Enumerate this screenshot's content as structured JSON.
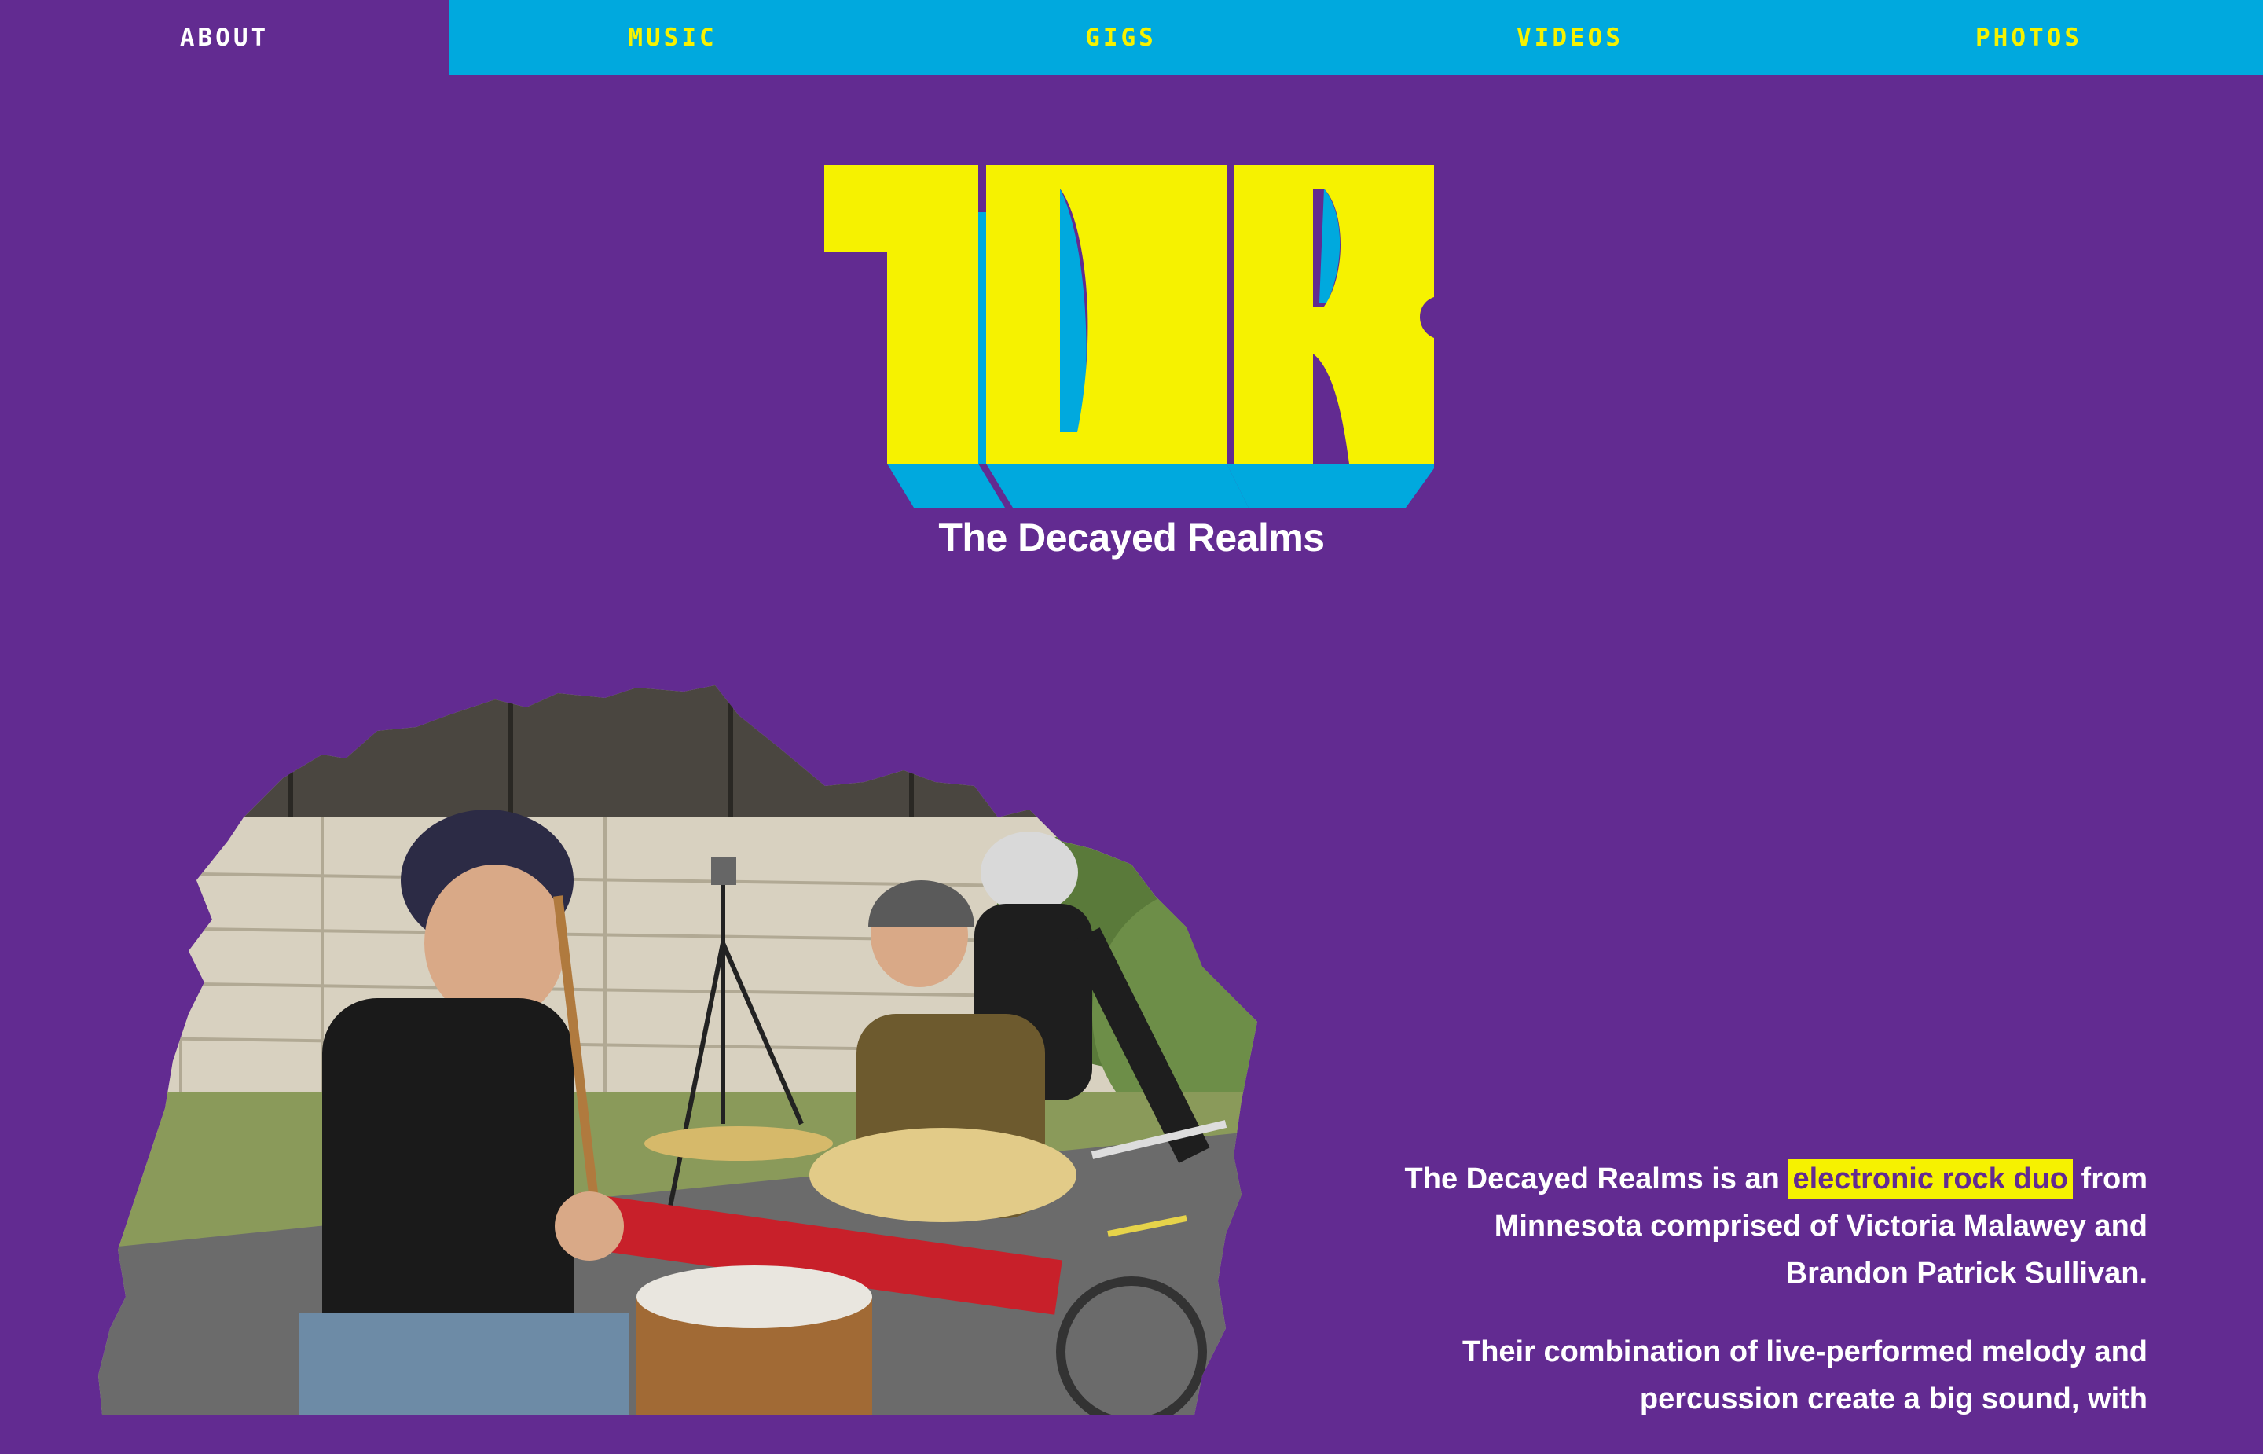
{
  "nav": {
    "items": [
      {
        "label": "ABOUT",
        "active": true
      },
      {
        "label": "MUSIC",
        "active": false
      },
      {
        "label": "GIGS",
        "active": false
      },
      {
        "label": "VIDEOS",
        "active": false
      },
      {
        "label": "PHOTOS",
        "active": false
      }
    ]
  },
  "logo": {
    "lettering": "TDR"
  },
  "header": {
    "band_name": "The Decayed Realms"
  },
  "about": {
    "p1_before": "The Decayed Realms is an ",
    "p1_highlight": "electronic rock duo",
    "p1_after": " from Minnesota comprised of Victoria Malawey and Brandon Patrick Sullivan.",
    "p2": "Their combination of live-performed melody and percussion create a big sound, with"
  },
  "colors": {
    "background": "#622b91",
    "nav_background": "#00a9de",
    "accent_yellow": "#f6f200",
    "logo_shadow": "#00a9de",
    "text_white": "#ffffff"
  }
}
